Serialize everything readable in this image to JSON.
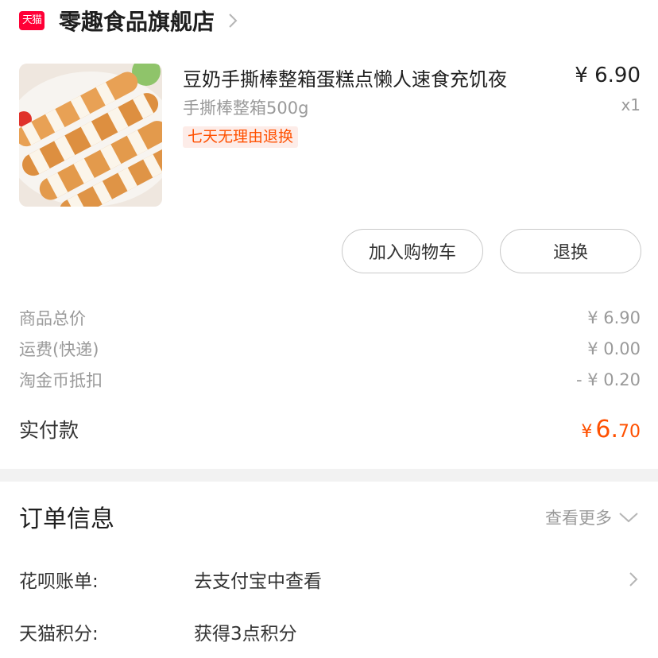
{
  "store": {
    "badge_text": "天猫",
    "name": "零趣食品旗舰店",
    "chevron_icon": "chevron-right-icon"
  },
  "product": {
    "image_alt": "product-thumbnail",
    "title": "豆奶手撕棒整箱蛋糕点懒人速食充饥夜",
    "price": "¥ 6.90",
    "spec": "手撕棒整箱500g",
    "quantity": "x1",
    "tag": "七天无理由退换"
  },
  "actions": {
    "add_to_cart": "加入购物车",
    "return_exchange": "退换"
  },
  "summary": {
    "goods_total_label": "商品总价",
    "goods_total_value": "¥ 6.90",
    "shipping_label": "运费(快递)",
    "shipping_value": "¥ 0.00",
    "coin_label": "淘金币抵扣",
    "coin_value": "- ¥ 0.20",
    "paid_label": "实付款",
    "paid_currency": "¥",
    "paid_int": "6.",
    "paid_dec": "70"
  },
  "order_info": {
    "title": "订单信息",
    "see_more": "查看更多",
    "rows": [
      {
        "key": "花呗账单:",
        "value": "去支付宝中查看"
      },
      {
        "key": "天猫积分:",
        "value": "获得3点积分"
      }
    ]
  },
  "colors": {
    "accent": "#ff5000",
    "tmall_red": "#ff0036",
    "muted": "#9a9a9a"
  }
}
